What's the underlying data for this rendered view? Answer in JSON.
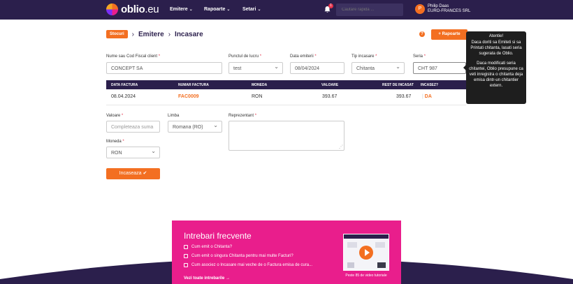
{
  "header": {
    "logo_main": "oblio",
    "logo_suffix": ".eu",
    "nav": [
      "Emitere",
      "Rapoarte",
      "Setari"
    ],
    "notifications": "1",
    "search_placeholder": "Cautare rapida ...",
    "user_initial": "P",
    "user_name": "Philip Daas",
    "user_company": "EURO-FRANCES SRL"
  },
  "breadcrumb": {
    "badge": "Stocuri",
    "items": [
      "Emitere",
      "Incasare"
    ],
    "separator": "›",
    "rapoarte_button": "+ Rapoarte"
  },
  "form": {
    "client_label": "Nume sau Cod Fiscal client",
    "client_value": "CONCEPT SA",
    "punct_label": "Punctul de lucru",
    "punct_value": "test",
    "data_label": "Data emiterii",
    "data_value": "08/04/2024",
    "tip_label": "Tip incasare",
    "tip_value": "Chitanta",
    "seria_label": "Seria",
    "seria_value": "CHT 987"
  },
  "table": {
    "headers": [
      "DATA FACTURA",
      "NUMAR FACTURA",
      "MONEDA",
      "VALOARE",
      "REST DE INCASAT",
      "INCASEZ?"
    ],
    "row": {
      "data": "08.04.2024",
      "numar": "FAC0009",
      "moneda": "RON",
      "valoare": "393.67",
      "rest": "393.67",
      "incasez": "DA"
    }
  },
  "payment": {
    "valoare_label": "Valoare",
    "valoare_placeholder": "Completeaza suma",
    "limba_label": "Limba",
    "limba_value": "Romana (RO)",
    "reprezentant_label": "Reprezentant",
    "moneda_label": "Moneda",
    "moneda_value": "RON",
    "submit": "Incaseaza ✔"
  },
  "tooltip": {
    "title": "Atentie!",
    "p1": "Daca doriti sa Emiteti si sa Printati chitanta, lasati seria sugerata de Oblio.",
    "p2": "Daca modificati seria chitantei, Oblio presupune ca veti inregistra o chitanta deja emisa dintr-un chitantier extern."
  },
  "faq": {
    "title": "Intrebari frecvente",
    "items": [
      "Cum emit o Chitanta?",
      "Cum emit o singura Chitanta pentru mai multe Facturi?",
      "Cum asociez o Incasare mai veche de o Factura emisa de cura..."
    ],
    "see_all": "Vezi toate intrebarile  →",
    "video_caption": "Peste 85 de video tutoriale"
  },
  "colors": {
    "brand_dark": "#2b1f4c",
    "accent": "#f36f21",
    "faq_pink": "#e91e8c"
  }
}
